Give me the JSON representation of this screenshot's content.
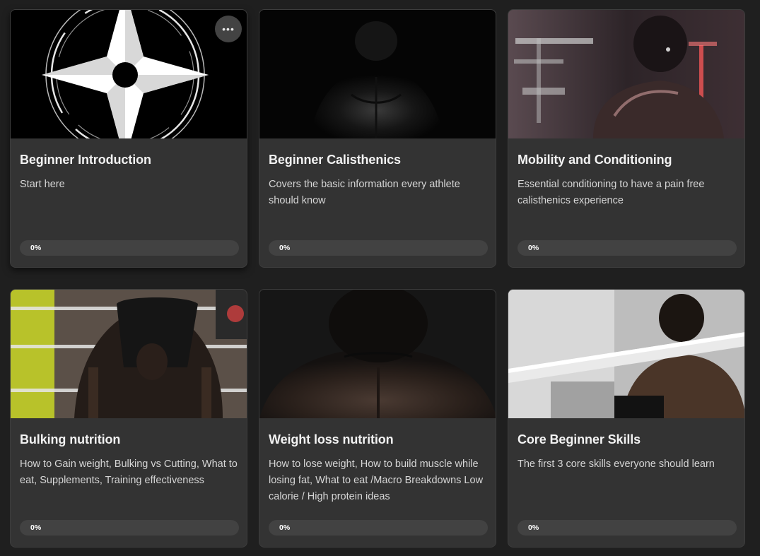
{
  "courses": [
    {
      "title": "Beginner Introduction",
      "description": "Start here",
      "progress_label": "0%",
      "progress": 0,
      "image": "shuriken-logo"
    },
    {
      "title": "Beginner Calisthenics",
      "description": "Covers the basic information every athlete should know",
      "progress_label": "0%",
      "progress": 0,
      "image": "athlete-back-dark"
    },
    {
      "title": "Mobility and Conditioning",
      "description": "Essential conditioning to have a pain free calisthenics experience",
      "progress_label": "0%",
      "progress": 0,
      "image": "athlete-gym-red"
    },
    {
      "title": "Bulking nutrition",
      "description": "How to Gain weight, Bulking vs Cutting, What to eat, Supplements, Training effectiveness",
      "progress_label": "0%",
      "progress": 0,
      "image": "athlete-bent-over"
    },
    {
      "title": "Weight loss nutrition",
      "description": "How to lose weight, How to build muscle while losing fat, What to eat /Macro Breakdowns Low calorie / High protein ideas",
      "progress_label": "0%",
      "progress": 0,
      "image": "athlete-back-closeup"
    },
    {
      "title": "Core Beginner Skills",
      "description": "The first 3 core skills everyone should learn",
      "progress_label": "0%",
      "progress": 0,
      "image": "athlete-bar"
    }
  ],
  "more_menu": {
    "label": "•••",
    "icon": "more-horizontal-icon"
  },
  "colors": {
    "background": "#1f1f1f",
    "card": "#333333",
    "progress_track": "#424242"
  }
}
